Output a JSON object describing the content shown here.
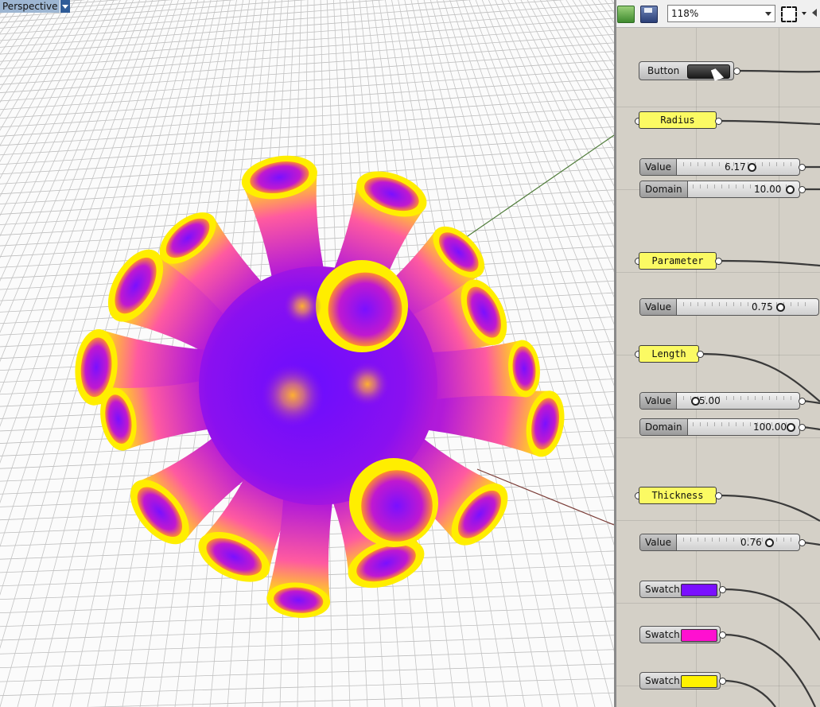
{
  "viewport": {
    "label": "Perspective",
    "colors": {
      "yellow": "#ffee00",
      "purple": "#8800ff",
      "magenta": "#d020c0",
      "orange": "#ffaa33"
    }
  },
  "toolbar": {
    "open_icon": "folder-open-icon",
    "save_icon": "save-disk-icon",
    "zoom": "118%",
    "zoom_extents_icon": "zoom-extents-icon"
  },
  "canvas": {
    "button": {
      "label": "Button"
    },
    "params": {
      "radius": "Radius",
      "parameter": "Parameter",
      "length": "Length",
      "thickness": "Thickness"
    },
    "sliders": {
      "radius_value": {
        "tag": "Value",
        "value": "6.17"
      },
      "radius_domain": {
        "tag": "Domain",
        "value": "10.00"
      },
      "parameter_value": {
        "tag": "Value",
        "value": "0.75"
      },
      "length_value": {
        "tag": "Value",
        "value": "5.00"
      },
      "length_domain": {
        "tag": "Domain",
        "value": "100.00"
      },
      "thickness_value": {
        "tag": "Value",
        "value": "0.76"
      }
    },
    "swatches": [
      {
        "label": "Swatch",
        "color": "#7a10ff"
      },
      {
        "label": "Swatch",
        "color": "#ff10d0"
      },
      {
        "label": "Swatch",
        "color": "#fff200"
      }
    ]
  }
}
